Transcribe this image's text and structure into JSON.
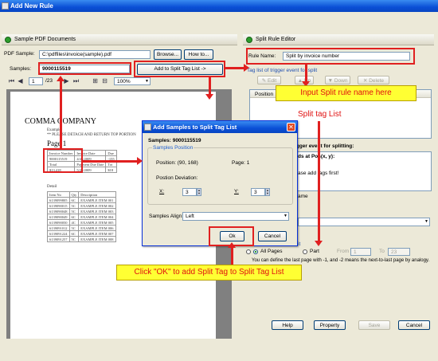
{
  "window": {
    "title": "Add New Rule"
  },
  "left": {
    "header": "Sample PDF Documents",
    "pdf_sample_label": "PDF Sample:",
    "pdf_sample_value": "C:\\pdffiles\\invoice(sample).pdf",
    "browse_label": "Browse...",
    "howto_label": "How to...",
    "samples_label": "Samples:",
    "samples_value": "9000115519",
    "add_split_label": "Add to Split Tag List ->",
    "page_number": "1",
    "page_total": "/23",
    "zoom": "100%"
  },
  "document": {
    "company": "COMMA COMPANY",
    "example": "Example",
    "note": "** PLEASE DETACH AND RETURN TOP PORTION",
    "page_heading": "Page 1",
    "head_table": [
      [
        "Invoice Number",
        "Invoice Date",
        "Due"
      ],
      [
        "9000115519",
        "4/23/2009",
        "-155"
      ],
      [
        "Total",
        "Payment Due Date",
        "Tot"
      ],
      [
        "$13,418",
        "5/23/2009",
        "$18"
      ]
    ],
    "detail": "Detail",
    "detail_table": [
      [
        "Item No",
        "Qty",
        "Description"
      ],
      [
        "6139099805",
        "6C",
        "EXAMPLE ITEM 001"
      ],
      [
        "6139090015",
        "5C",
        "EXAMPLE ITEM 002"
      ],
      [
        "6139090048",
        "5C",
        "EXAMPLE ITEM 003"
      ],
      [
        "6139090049",
        "6C",
        "EXAMPLE ITEM 004"
      ],
      [
        "6139090050",
        "4C",
        "EXAMPLE ITEM 005"
      ],
      [
        "6139091012",
        "5C",
        "EXAMPLE ITEM 006"
      ],
      [
        "6139091224",
        "6C",
        "EXAMPLE ITEM 007"
      ],
      [
        "6139091257",
        "5C",
        "EXAMPLE ITEM 008"
      ]
    ]
  },
  "right": {
    "header": "Split Rule Editor",
    "rule_name_label": "Rule Name:",
    "rule_name_value": "Split by invoice number",
    "tag_list_link": "Tag list of trigger event for split",
    "edit_label": "Edit",
    "up_label": "Up",
    "down_label": "Down",
    "delete_label": "Delete",
    "col_position": "Position",
    "trigger_text": "igger event for splitting:",
    "fields_at_pos": "ds at Pos(x, y):",
    "add_tags_first": "ase add tags first!",
    "name_frag": "ame",
    "it_frag": "it",
    "all_pages": "All Pages",
    "part_label": "Part",
    "from_label": "From",
    "from_value": "1",
    "to_label": "To",
    "to_value": "23",
    "range_note": "You can define the last page with -1, and -2 means the next-to-last page by analogy.",
    "help_label": "Help",
    "property_label": "Property",
    "save_label": "Save",
    "cancel_label": "Cancel"
  },
  "dialog": {
    "title": "Add Samples to Split Tag List",
    "samples_text": "Samples: 9000115519",
    "group_label": "Samples Position",
    "position_text": "Position: (90, 168)",
    "page_text": "Page: 1",
    "deviation_label": "Postion Deviation:",
    "x_label": "X:",
    "x_value": "3",
    "y_label": "Y:",
    "y_value": "3",
    "align_label": "Samples Align:",
    "align_value": "Left",
    "ok_label": "Ok",
    "cancel_label": "Cancel"
  },
  "annotations": {
    "input_rule": "Input Split rule name here",
    "split_tag_list": "Split tag List",
    "click_ok": "Click \"OK\" to add Split Tag to Split Tag List"
  },
  "colors": {
    "annotation_red": "#e02020",
    "callout_yellow": "#ffff33",
    "title_blue": "#0a4fd6"
  }
}
